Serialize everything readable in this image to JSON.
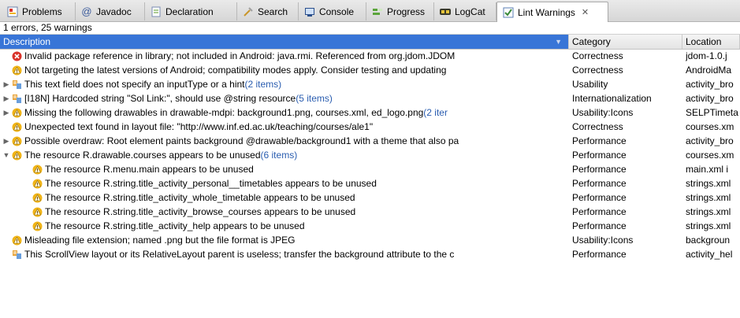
{
  "tabs": [
    {
      "label": "Problems",
      "icon": "problems-icon"
    },
    {
      "label": "Javadoc",
      "icon": "javadoc-icon"
    },
    {
      "label": "Declaration",
      "icon": "declaration-icon"
    },
    {
      "label": "Search",
      "icon": "search-icon"
    },
    {
      "label": "Console",
      "icon": "console-icon"
    },
    {
      "label": "Progress",
      "icon": "progress-icon"
    },
    {
      "label": "LogCat",
      "icon": "logcat-icon"
    },
    {
      "label": "Lint Warnings",
      "icon": "lint-warnings-icon",
      "active": true
    }
  ],
  "close_glyph": "✕",
  "status": "1 errors, 25 warnings",
  "columns": {
    "description": "Description",
    "category": "Category",
    "location": "Location"
  },
  "sort_glyph": "▼",
  "colors": {
    "error": "#d9332b",
    "warning": "#f0b418",
    "info": "#e8a43a",
    "link": "#2a5db0",
    "header_selected": "#3875d7"
  },
  "rows": [
    {
      "twisty": "",
      "icon": "error",
      "indent": 0,
      "text": "Invalid package reference in library; not included in Android: java.rmi. Referenced from org.jdom.JDOM",
      "count": "",
      "category": "Correctness",
      "location": "jdom-1.0.j"
    },
    {
      "twisty": "",
      "icon": "warning",
      "indent": 0,
      "text": "Not targeting the latest versions of Android; compatibility modes apply. Consider testing and updating",
      "count": "",
      "category": "Correctness",
      "location": "AndroidMa"
    },
    {
      "twisty": "closed",
      "icon": "info",
      "indent": 0,
      "text": "This text field does not specify an inputType or a hint ",
      "count": "(2 items)",
      "category": "Usability",
      "location": "activity_bro"
    },
    {
      "twisty": "closed",
      "icon": "info",
      "indent": 0,
      "text": "[I18N] Hardcoded string \"Sol Link:\", should use @string resource ",
      "count": "(5 items)",
      "category": "Internationalization",
      "location": "activity_bro"
    },
    {
      "twisty": "closed",
      "icon": "warning",
      "indent": 0,
      "text": "Missing the following drawables in drawable-mdpi: background1.png, courses.xml, ed_logo.png ",
      "count": "(2 iter",
      "category": "Usability:Icons",
      "location": "SELPTimeta"
    },
    {
      "twisty": "",
      "icon": "warning",
      "indent": 0,
      "text": "Unexpected text found in layout file: \"http://www.inf.ed.ac.uk/teaching/courses/ale1\"",
      "count": "",
      "category": "Correctness",
      "location": "courses.xm"
    },
    {
      "twisty": "closed",
      "icon": "warning",
      "indent": 0,
      "text": "Possible overdraw: Root element paints background @drawable/background1 with a theme that also pa",
      "count": "",
      "category": "Performance",
      "location": "activity_bro"
    },
    {
      "twisty": "open",
      "icon": "warning",
      "indent": 0,
      "text": "The resource R.drawable.courses appears to be unused ",
      "count": "(6 items)",
      "category": "Performance",
      "location": "courses.xm"
    },
    {
      "twisty": "",
      "icon": "warning",
      "indent": 1,
      "text": "The resource R.menu.main appears to be unused",
      "count": "",
      "category": "Performance",
      "location": "main.xml i"
    },
    {
      "twisty": "",
      "icon": "warning",
      "indent": 1,
      "text": "The resource R.string.title_activity_personal__timetables appears to be unused",
      "count": "",
      "category": "Performance",
      "location": "strings.xml"
    },
    {
      "twisty": "",
      "icon": "warning",
      "indent": 1,
      "text": "The resource R.string.title_activity_whole_timetable appears to be unused",
      "count": "",
      "category": "Performance",
      "location": "strings.xml"
    },
    {
      "twisty": "",
      "icon": "warning",
      "indent": 1,
      "text": "The resource R.string.title_activity_browse_courses appears to be unused",
      "count": "",
      "category": "Performance",
      "location": "strings.xml"
    },
    {
      "twisty": "",
      "icon": "warning",
      "indent": 1,
      "text": "The resource R.string.title_activity_help appears to be unused",
      "count": "",
      "category": "Performance",
      "location": "strings.xml"
    },
    {
      "twisty": "",
      "icon": "warning",
      "indent": 0,
      "text": "Misleading file extension; named .png but the file format is JPEG",
      "count": "",
      "category": "Usability:Icons",
      "location": "backgroun"
    },
    {
      "twisty": "",
      "icon": "info",
      "indent": 0,
      "text": "This ScrollView layout or its RelativeLayout parent is useless; transfer the background attribute to the c",
      "count": "",
      "category": "Performance",
      "location": "activity_hel"
    }
  ]
}
